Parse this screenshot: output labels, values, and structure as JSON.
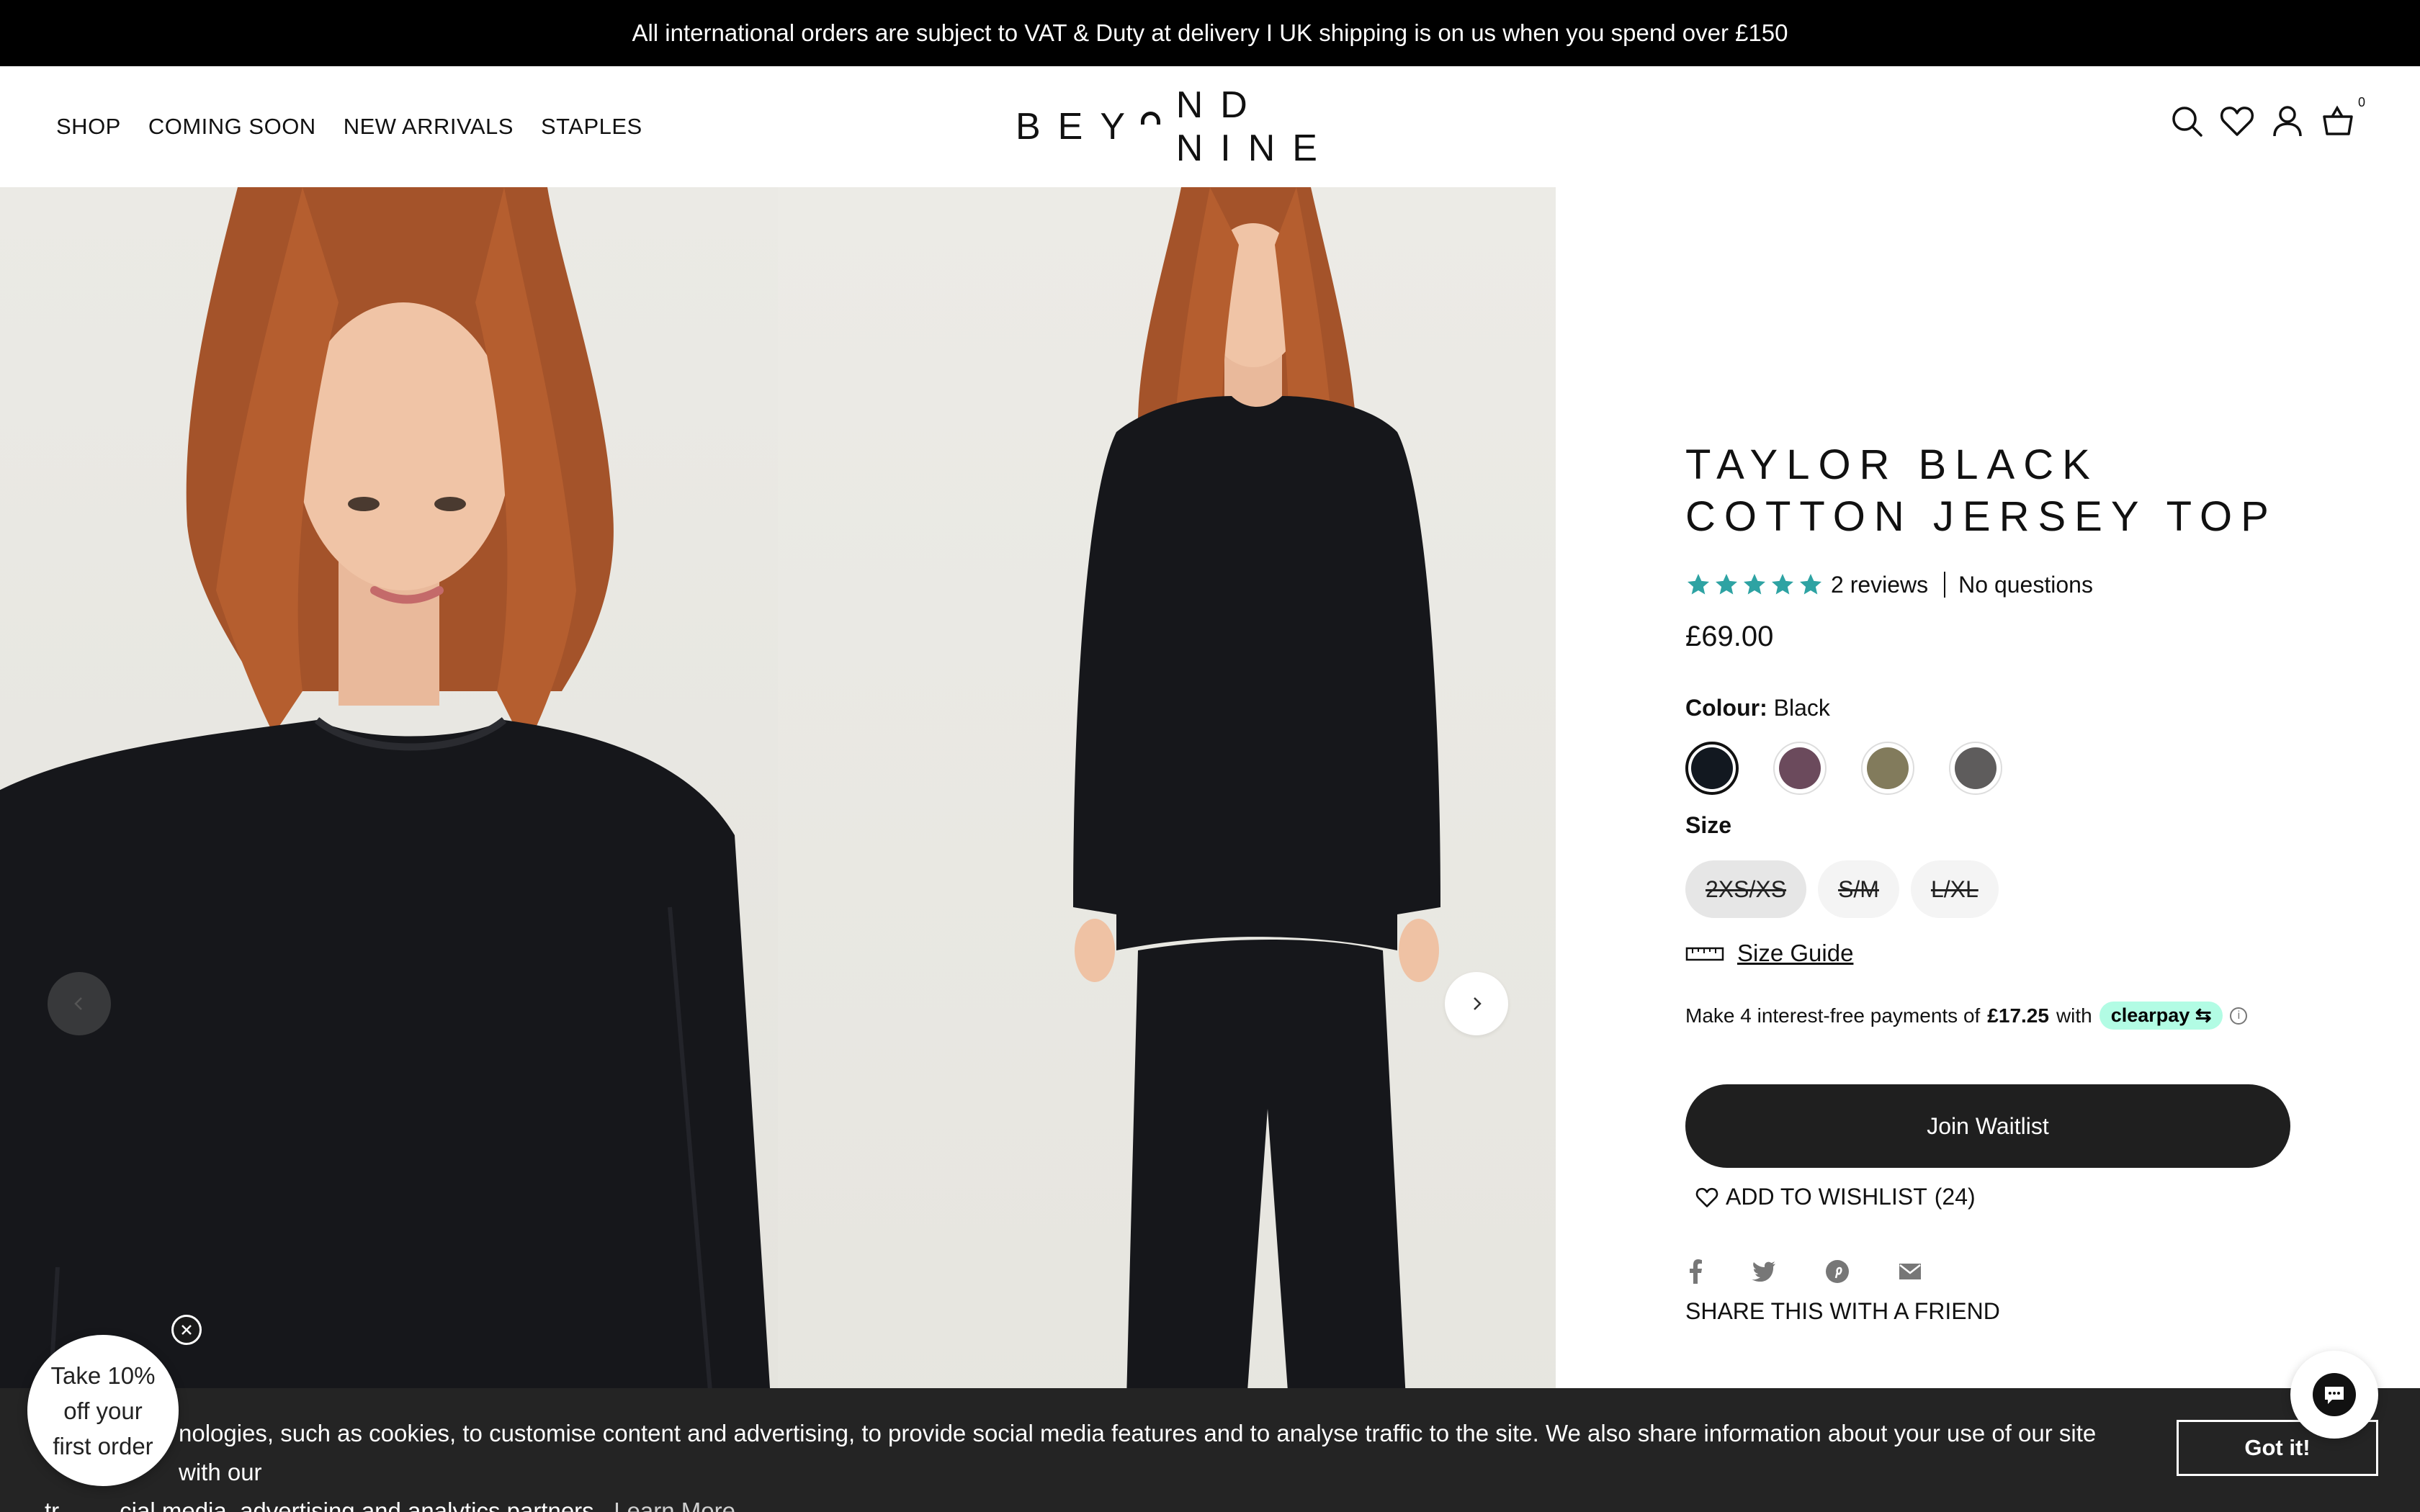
{
  "announcement": "All international orders are subject to VAT & Duty at delivery I UK shipping is on us when you spend over £150",
  "nav": [
    "SHOP",
    "COMING SOON",
    "NEW ARRIVALS",
    "STAPLES"
  ],
  "brand": {
    "part1": "BEY",
    "part2": "ND NINE"
  },
  "header_icons": [
    "search-icon",
    "heart-icon",
    "account-icon",
    "cart-icon"
  ],
  "cart_count": "0",
  "product": {
    "title_line1": "TAYLOR BLACK",
    "title_line2": "COTTON JERSEY TOP",
    "rating": 5,
    "reviews": "2 reviews",
    "questions": "No questions",
    "price": "£69.00",
    "colour_label": "Colour:",
    "colour_value": "Black",
    "swatches": [
      "#121820",
      "#6b4a5c",
      "#827b5c",
      "#5e5c5c"
    ],
    "size_label": "Size",
    "sizes": [
      "2XS/XS",
      "S/M",
      "L/XL"
    ],
    "size_guide": "Size Guide",
    "clearpay_prefix": "Make 4 interest-free payments of",
    "clearpay_amount": "£17.25",
    "clearpay_with": "with",
    "clearpay_brand": "clearpay",
    "waitlist": "Join Waitlist",
    "wishlist": "ADD TO WISHLIST",
    "wishlist_count": "(24)",
    "share_title": "SHARE THIS WITH A FRIEND",
    "share_icons": [
      "facebook-icon",
      "twitter-icon",
      "pinterest-icon",
      "email-icon"
    ]
  },
  "colors": {
    "star": "#2ea3a3",
    "button": "#1f1f1f",
    "clearpay": "#b2fce4"
  },
  "cookie": {
    "line1": "nologies, such as cookies, to customise content and advertising, to provide social media features and to analyse traffic to the site. We also share information about your use of our site with our",
    "line2_prefix": "tr",
    "line2_mid": "cial media, advertising and analytics partners.",
    "learn_more": "Learn More",
    "got_it": "Got it!"
  },
  "discount": {
    "line1": "Take 10%",
    "line2": "off your",
    "line3": "first order"
  }
}
